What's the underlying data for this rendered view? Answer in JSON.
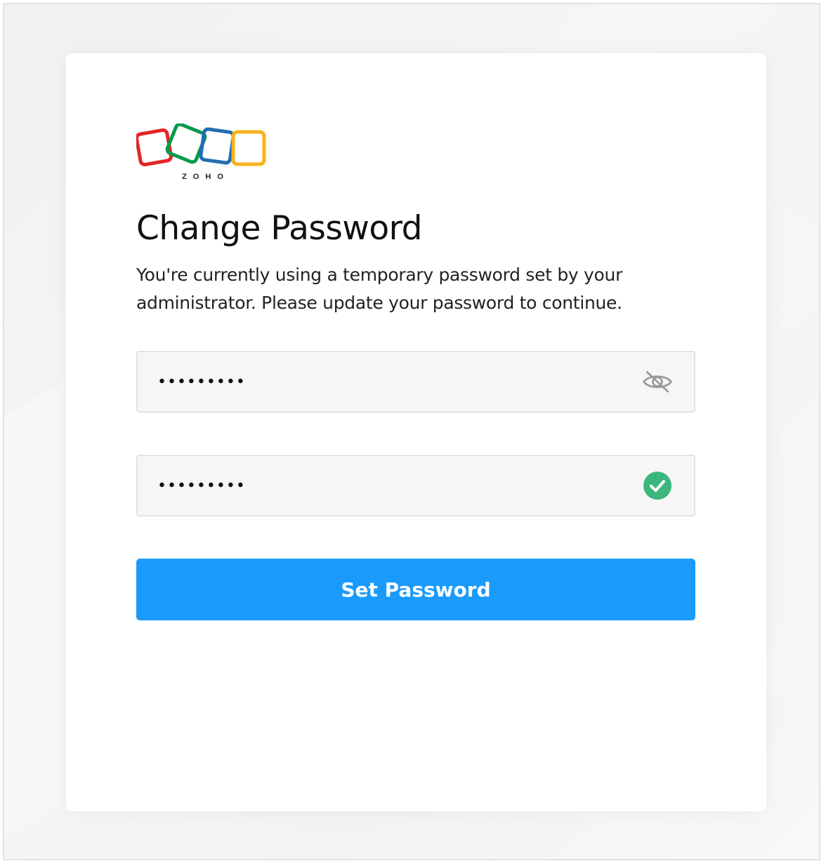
{
  "logo": {
    "wordmark": "ZOHO",
    "colors": [
      "#e42527",
      "#089949",
      "#226db4",
      "#f9b21d"
    ]
  },
  "page": {
    "title": "Change Password",
    "description": "You're currently using a temporary password set by your administrator. Please update your password to continue."
  },
  "fields": {
    "new_password": {
      "value": "•••••••••",
      "icon": "eye-slash-icon",
      "icon_color": "#9a9a9a"
    },
    "confirm_password": {
      "value": "•••••••••",
      "icon": "check-circle-icon",
      "icon_color": "#3bb77e"
    }
  },
  "actions": {
    "submit_label": "Set Password",
    "submit_color": "#1a9bfc"
  }
}
